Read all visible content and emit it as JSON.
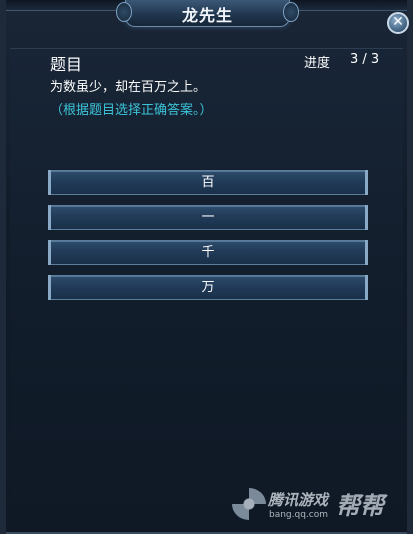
{
  "window": {
    "title": "龙先生",
    "close_symbol": "✕"
  },
  "quiz": {
    "section_title": "题目",
    "progress_label": "进度",
    "progress_value": "3 / 3",
    "question": "为数虽少，却在百万之上。",
    "hint": "（根据题目选择正确答案。）",
    "options": [
      {
        "label": "百"
      },
      {
        "label": "一"
      },
      {
        "label": "千"
      },
      {
        "label": "万"
      }
    ]
  },
  "watermark": {
    "brand": "腾讯游戏",
    "product": "帮帮",
    "url": "bang.qq.com"
  },
  "colors": {
    "hint": "#3cc3d8",
    "text": "#ffffff",
    "panel": "#121c29"
  }
}
